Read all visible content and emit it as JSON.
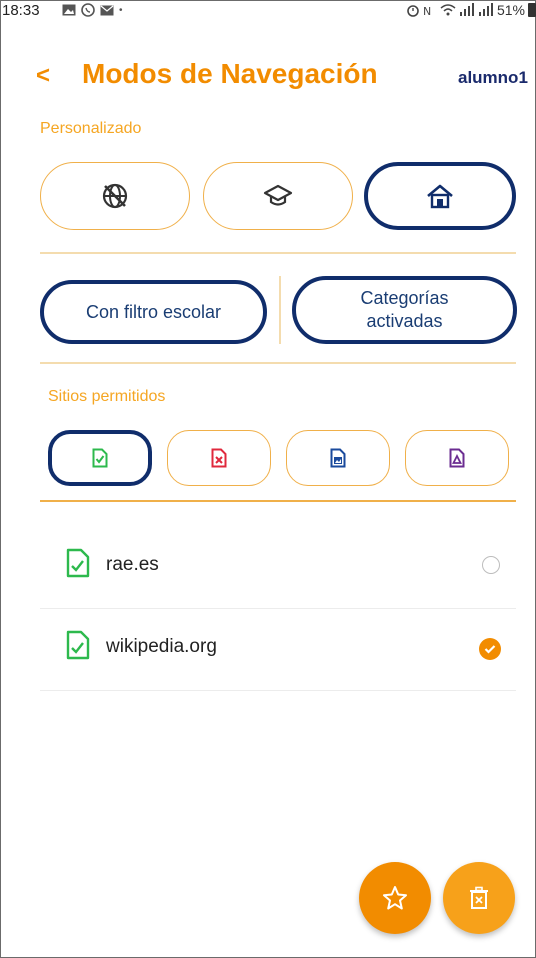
{
  "status": {
    "time": "18:33",
    "battery": "51%"
  },
  "header": {
    "title": "Modos de Navegación",
    "user": "alumno1"
  },
  "personalizado": {
    "label": "Personalizado",
    "buttons": [
      "globe-off-icon",
      "graduation-cap-icon",
      "home-icon"
    ],
    "selected": 2
  },
  "filters": {
    "con_filtro": "Con filtro escolar",
    "categorias_line1": "Categorías",
    "categorias_line2": "activadas"
  },
  "sitios": {
    "label": "Sitios permitidos"
  },
  "sites": [
    {
      "name": "rae.es",
      "checked": false
    },
    {
      "name": "wikipedia.org",
      "checked": true
    }
  ],
  "colors": {
    "accent": "#f28c00",
    "navy": "#102d6b",
    "green": "#2db94d",
    "red": "#e0283c",
    "blue": "#1a4a9c",
    "purple": "#6b2c91"
  }
}
